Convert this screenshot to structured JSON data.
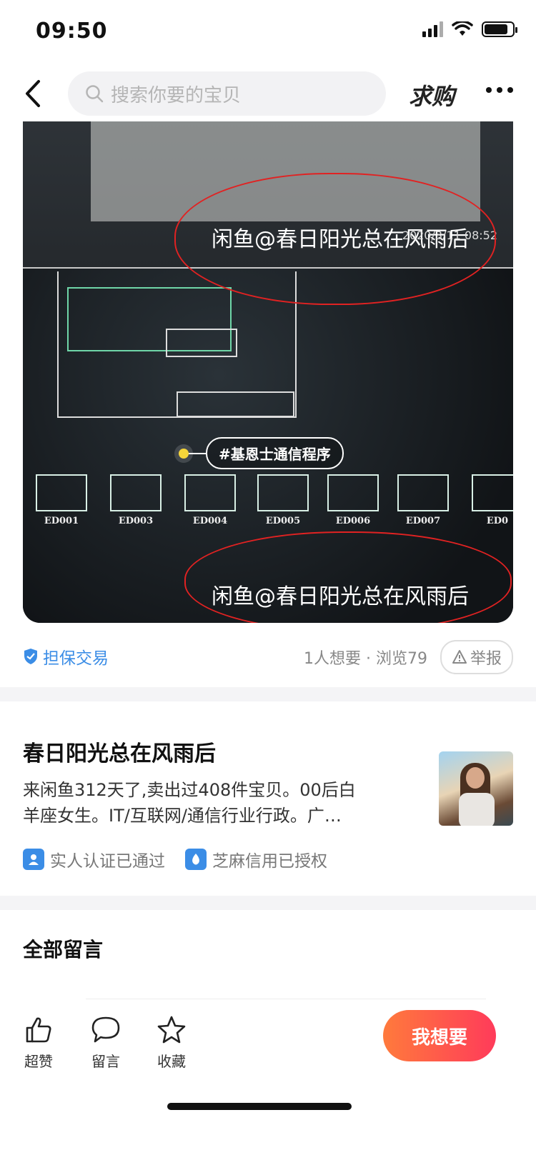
{
  "status_bar": {
    "time": "09:50"
  },
  "nav": {
    "search_placeholder": "搜索你要的宝贝",
    "qiugou_label": "求购"
  },
  "photo": {
    "watermark": "闲鱼@春日阳光总在风雨后",
    "timestamp": "2020/3/11 08:52",
    "tag_label": "#基恩士通信程序",
    "thumb_labels": [
      "ED001",
      "ED003",
      "ED004",
      "ED005",
      "ED006",
      "ED007",
      "ED0"
    ]
  },
  "meta": {
    "guarantee_label": "担保交易",
    "stats": "1人想要 · 浏览79",
    "report_label": "举报"
  },
  "seller": {
    "name": "春日阳光总在风雨后",
    "bio_line1": "来闲鱼312天了,卖出过408件宝贝。00后白",
    "bio_line2": "羊座女生。IT/互联网/通信行业行政。广…",
    "badge_real_name": "实人认证已通过",
    "badge_sesame": "芝麻信用已授权"
  },
  "comments": {
    "title": "全部留言"
  },
  "bottom_bar": {
    "like_label": "超赞",
    "comment_label": "留言",
    "favorite_label": "收藏",
    "want_label": "我想要"
  },
  "colors": {
    "accent_blue": "#3b8de6",
    "cta_start": "#ff7a3c",
    "cta_end": "#ff3b5a",
    "annotation_red": "#e12222"
  }
}
